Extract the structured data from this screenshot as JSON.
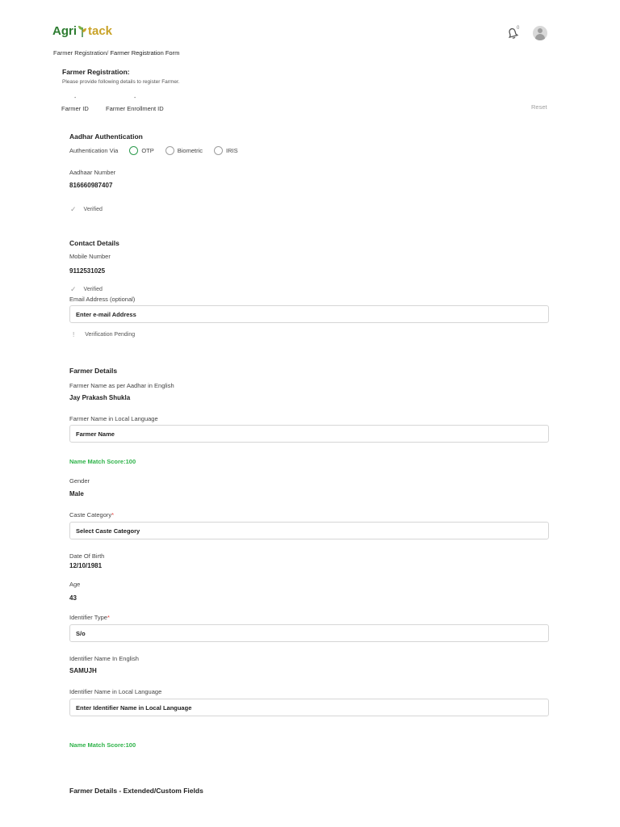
{
  "header": {
    "logo_agri": "Agri",
    "logo_stack": "tack",
    "notification_count": "0"
  },
  "breadcrumb": {
    "parent": "Farmer Registration",
    "separator": "/",
    "current": "Farmer Registration Form"
  },
  "form": {
    "title": "Farmer Registration:",
    "subtitle": "Please provide following details to register Farmer.",
    "farmer_id_value": "-",
    "farmer_id_label": "Farmer ID",
    "enrollment_id_value": "-",
    "enrollment_id_label": "Farmer Enrollment ID",
    "reset_label": "Reset"
  },
  "aadhar": {
    "title": "Aadhar Authentication",
    "auth_via_label": "Authentication Via",
    "options": [
      "OTP",
      "Biometric",
      "IRIS"
    ],
    "number_label": "Aadhaar Number",
    "number_value": "816660987407",
    "verified_label": "Verified"
  },
  "contact": {
    "title": "Contact Details",
    "mobile_label": "Mobile Number",
    "mobile_value": "9112531025",
    "verified_label": "Verified",
    "email_label": "Email Address (optional)",
    "email_placeholder": "Enter e-mail Address",
    "email_status": "Verification Pending"
  },
  "farmer": {
    "title": "Farmer Details",
    "name_en_label": "Farmer Name as per Aadhar in English",
    "name_en_value": "Jay Prakash Shukla",
    "name_local_label": "Farmer Name in Local Language",
    "name_local_placeholder": "Farmer Name",
    "name_match_score": "Name Match Score:100",
    "gender_label": "Gender",
    "gender_value": "Male",
    "caste_label": "Caste Category",
    "caste_placeholder": "Select Caste Category",
    "dob_label": "Date Of Birth",
    "dob_value": "12/10/1981",
    "age_label": "Age",
    "age_value": "43",
    "identifier_type_label": "Identifier Type",
    "identifier_type_value": "S/o",
    "identifier_name_en_label": "Identifier Name In English",
    "identifier_name_en_value": "SAMUJH",
    "identifier_name_local_label": "Identifier Name in Local Language",
    "identifier_name_local_placeholder": "Enter Identifier Name in Local Language",
    "identifier_match_score": "Name Match Score:100",
    "required_mark": "*"
  },
  "extended": {
    "title": "Farmer Details - Extended/Custom Fields"
  },
  "colors": {
    "brand_green": "#2e7d32",
    "brand_gold": "#c9a227",
    "score_green": "#2fb34a",
    "required_red": "#e53935"
  }
}
